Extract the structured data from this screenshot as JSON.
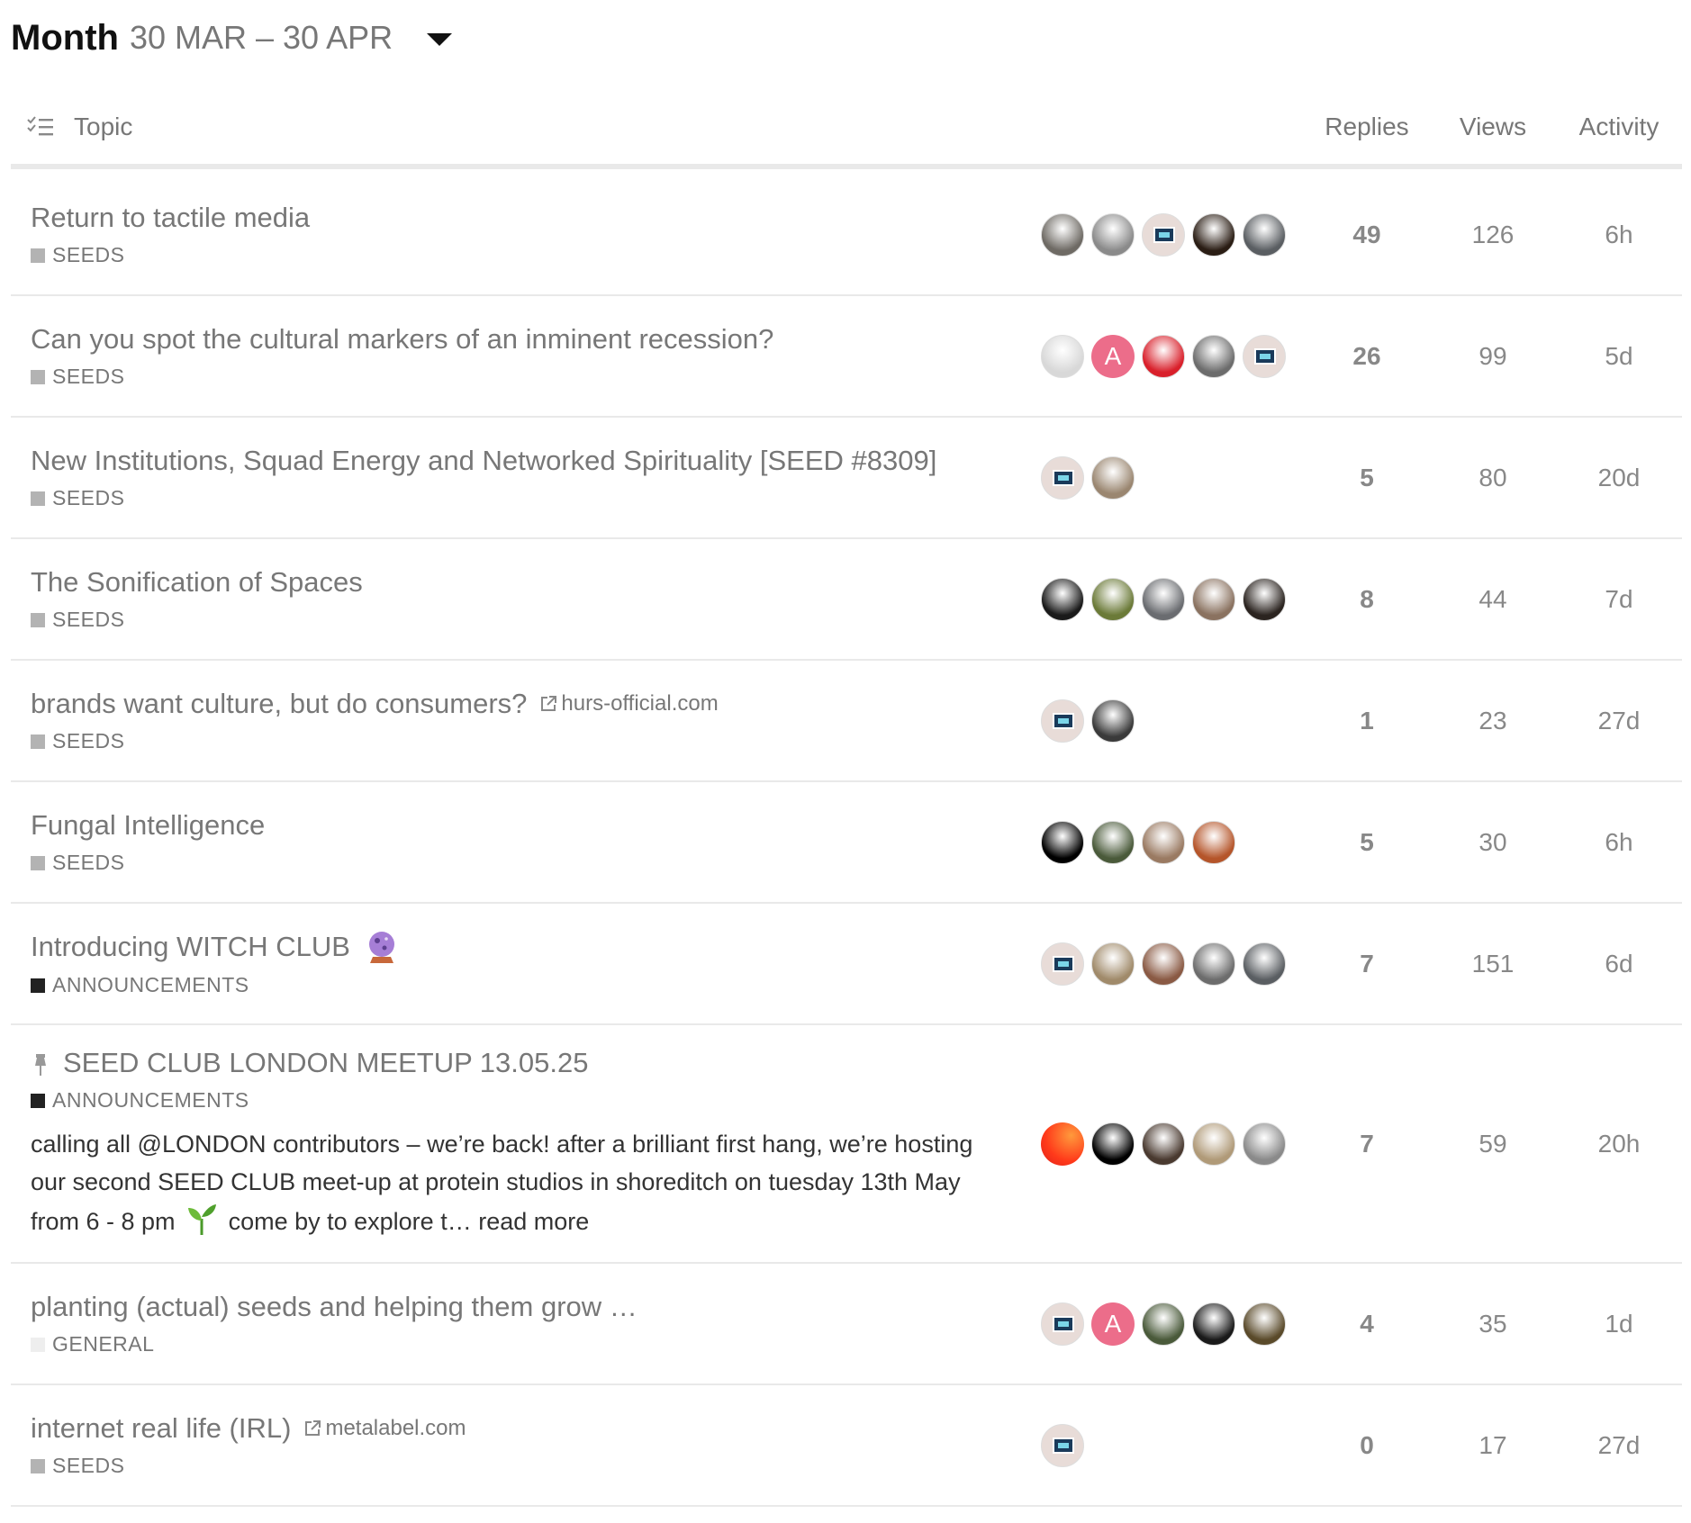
{
  "period": {
    "label": "Month",
    "range": "30 MAR – 30 APR"
  },
  "header": {
    "topic": "Topic",
    "replies": "Replies",
    "views": "Views",
    "activity": "Activity"
  },
  "colors": {
    "seeds": "#b3b3b3",
    "announcements": "#222222",
    "general": "#eeeeee"
  },
  "topics": [
    {
      "title": "Return to tactile media",
      "category": "SEEDS",
      "category_color": "#b3b3b3",
      "posters": [
        "#6e6a64",
        "#8a8a8a",
        "logo",
        "#2a1d14",
        "#5a5e62"
      ],
      "replies": "49",
      "views": "126",
      "activity": "6h"
    },
    {
      "title": "Can you spot the cultural markers of an inminent recession?",
      "category": "SEEDS",
      "category_color": "#b3b3b3",
      "posters": [
        "#d8d8d8",
        "letter:A:#ec6d8a",
        "#d9202b",
        "#6c6c6c",
        "logo"
      ],
      "replies": "26",
      "views": "99",
      "activity": "5d"
    },
    {
      "title": "New Institutions, Squad Energy and Networked Spirituality [SEED #8309]",
      "category": "SEEDS",
      "category_color": "#b3b3b3",
      "posters": [
        "logo",
        "#9a8670"
      ],
      "replies": "5",
      "views": "80",
      "activity": "20d"
    },
    {
      "title": "The Sonification of Spaces",
      "category": "SEEDS",
      "category_color": "#b3b3b3",
      "posters": [
        "#1a1a1a",
        "#6b7a38",
        "#6a6c70",
        "#8a7260",
        "#2b2420"
      ],
      "replies": "8",
      "views": "44",
      "activity": "7d"
    },
    {
      "title": "brands want culture, but do consumers?",
      "link": "hurs-official.com",
      "category": "SEEDS",
      "category_color": "#b3b3b3",
      "posters": [
        "logo",
        "#3a3a3a"
      ],
      "replies": "1",
      "views": "23",
      "activity": "27d"
    },
    {
      "title": "Fungal Intelligence",
      "category": "SEEDS",
      "category_color": "#b3b3b3",
      "posters": [
        "#000000",
        "#4a5a3a",
        "#9a7a62",
        "#b5552a"
      ],
      "replies": "5",
      "views": "30",
      "activity": "6h"
    },
    {
      "title": "Introducing WITCH CLUB",
      "emoji": "crystal-ball",
      "category": "ANNOUNCEMENTS",
      "category_color": "#222222",
      "posters": [
        "logo",
        "#a08a6a",
        "#8a5a44",
        "#6c6c6c",
        "#5a5e62"
      ],
      "replies": "7",
      "views": "151",
      "activity": "6d"
    },
    {
      "title": "SEED CLUB LONDON MEETUP 13.05.25",
      "pinned": true,
      "category": "ANNOUNCEMENTS",
      "category_color": "#222222",
      "excerpt_a": "calling all @LONDON contributors – we’re back! after a brilliant first hang, we’re hosting our second SEED CLUB meet-up at protein studios in shoreditch on tuesday 13th May from 6 - 8 pm",
      "excerpt_b": "come by to explore t…",
      "read_more": "read more",
      "posters": [
        "grad",
        "#000000",
        "#4a3a30",
        "#b09a78",
        "#8a8a8a"
      ],
      "replies": "7",
      "views": "59",
      "activity": "20h"
    },
    {
      "title": "planting (actual) seeds and helping them grow …",
      "category": "GENERAL",
      "category_color": "#eeeeee",
      "posters": [
        "logo",
        "letter:A:#ec6d8a",
        "#4a5a3a",
        "#1a1a1a",
        "#5a4a2a"
      ],
      "replies": "4",
      "views": "35",
      "activity": "1d"
    },
    {
      "title": "internet real life (IRL)",
      "link": "metalabel.com",
      "category": "SEEDS",
      "category_color": "#b3b3b3",
      "posters": [
        "logo"
      ],
      "replies": "0",
      "views": "17",
      "activity": "27d"
    }
  ]
}
